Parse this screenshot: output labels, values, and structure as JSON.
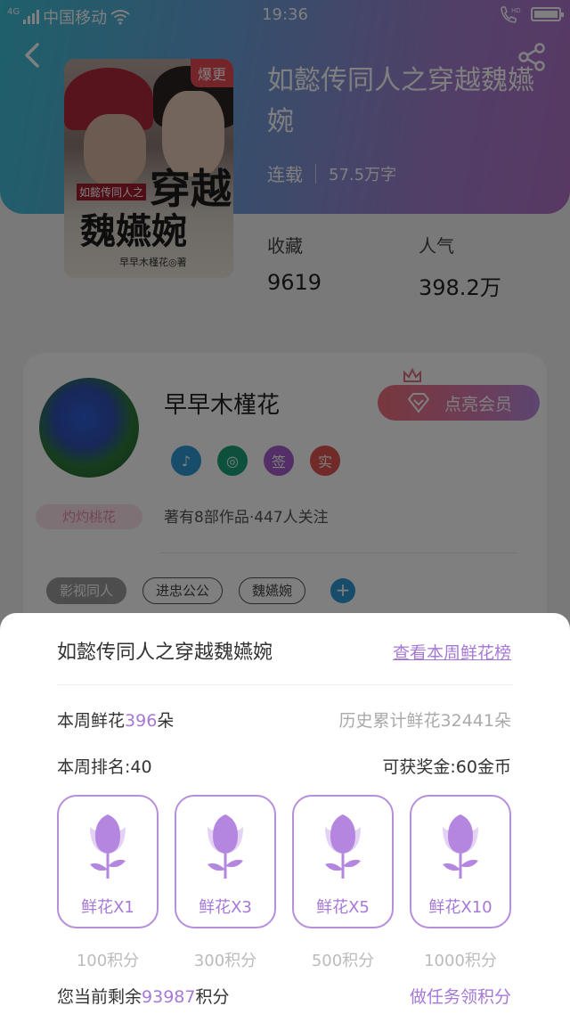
{
  "statusbar": {
    "network": "4G",
    "carrier": "中国移动",
    "time": "19:36",
    "hd": "HD"
  },
  "book": {
    "title": "如懿传同人之穿越魏嬿婉",
    "status": "连载",
    "words": "57.5万字",
    "badge": "爆更",
    "cover_small_title": "如懿传同人之",
    "cover_line1": "穿越",
    "cover_line2": "魏嬿婉",
    "cover_author": "早早木槿花◎著"
  },
  "stats": {
    "fav_label": "收藏",
    "fav_value": "9619",
    "pop_label": "人气",
    "pop_value": "398.2万"
  },
  "author": {
    "name": "早早木槿花",
    "vip_button": "点亮会员",
    "avatar_tag": "灼灼桃花",
    "badges": [
      "♪",
      "◎",
      "签",
      "实"
    ],
    "badge_colors": [
      "#2f9bd6",
      "#1aa37a",
      "#a65dcf",
      "#e0554f"
    ],
    "summary": "著有8部作品·447人关注",
    "tags": [
      "影视同人",
      "进忠公公",
      "魏嬿婉"
    ]
  },
  "sheet": {
    "title": "如懿传同人之穿越魏嬿婉",
    "rank_link": "查看本周鲜花榜",
    "week_prefix": "本周鲜花",
    "week_count": "396",
    "week_suffix": "朵",
    "history": "历史累计鲜花32441朵",
    "rank": "本周排名:40",
    "reward": "可获奖金:60金币",
    "options": [
      {
        "label": "鲜花X1",
        "price": "100积分"
      },
      {
        "label": "鲜花X3",
        "price": "300积分"
      },
      {
        "label": "鲜花X5",
        "price": "500积分"
      },
      {
        "label": "鲜花X10",
        "price": "1000积分"
      }
    ],
    "remain_prefix": "您当前剩余",
    "remain_points": "93987",
    "remain_suffix": "积分",
    "task_link": "做任务领积分"
  },
  "colors": {
    "accent": "#a679d6",
    "hero_start": "#3cc0d6",
    "hero_end": "#b072c8"
  }
}
